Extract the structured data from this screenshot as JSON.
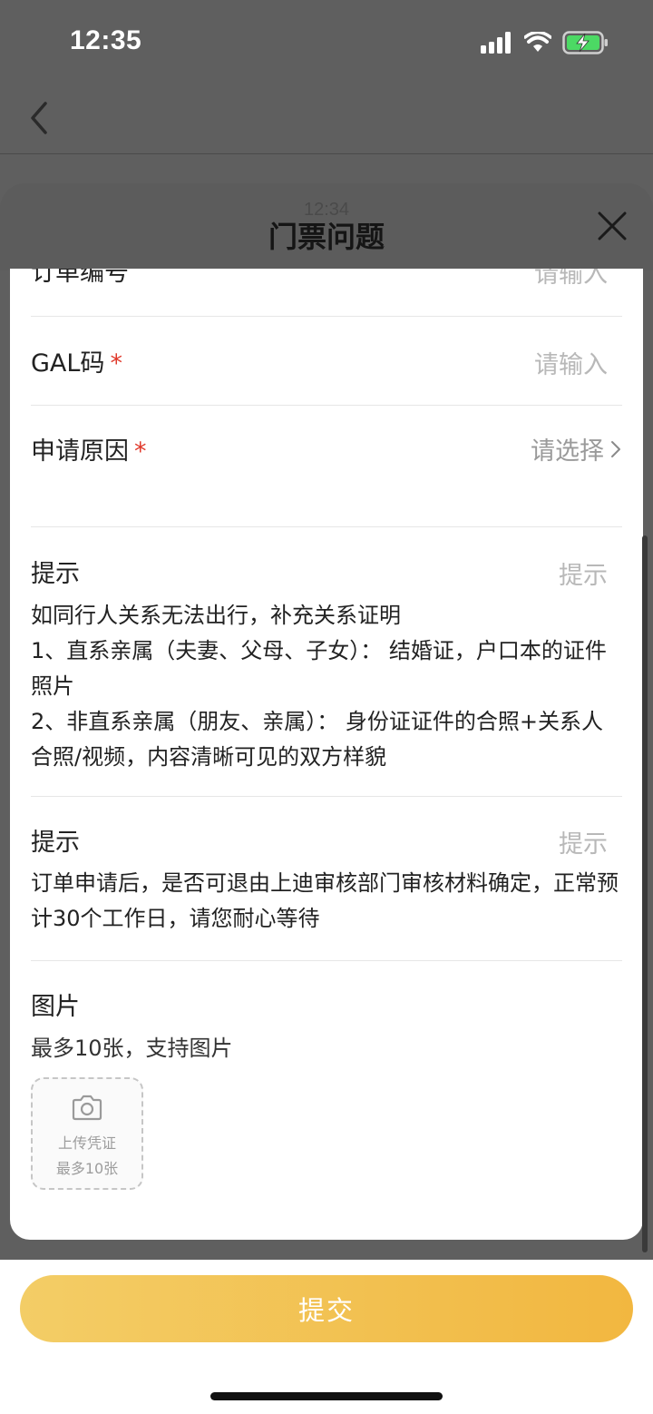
{
  "status_bar": {
    "time": "12:35"
  },
  "sheet": {
    "ghost_time": "12:34",
    "title": "门票问题"
  },
  "form": {
    "order_number": {
      "label": "订单编号",
      "placeholder": "请输入"
    },
    "gal_code": {
      "label": "GAL码",
      "required_mark": "*",
      "placeholder": "请输入"
    },
    "reason": {
      "label": "申请原因",
      "required_mark": "*",
      "select_placeholder": "请选择"
    },
    "tip1": {
      "label": "提示",
      "placeholder": "提示",
      "content": "如同行人关系无法出行，补充关系证明\n1、直系亲属（夫妻、父母、子女）： 结婚证，户口本的证件照片\n2、非直系亲属（朋友、亲属）： 身份证证件的合照+关系人合照/视频，内容清晰可见的双方样貌"
    },
    "tip2": {
      "label": "提示",
      "placeholder": "提示",
      "content": "订单申请后，是否可退由上迪审核部门审核材料确定，正常预计30个工作日，请您耐心等待"
    },
    "images": {
      "label": "图片",
      "hint": "最多10张，支持图片",
      "upload_line1": "上传凭证",
      "upload_line2": "最多10张"
    }
  },
  "submit_label": "提交",
  "colors": {
    "accent_start": "#f3cd66",
    "accent_end": "#f2b740",
    "required": "#e0392b"
  }
}
